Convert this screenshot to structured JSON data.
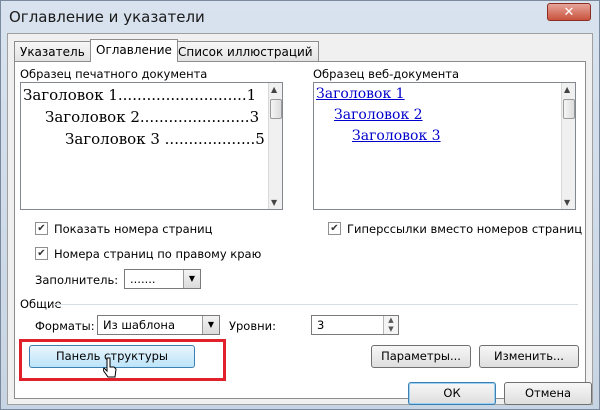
{
  "window": {
    "title": "Оглавление и указатели",
    "close_glyph": "✕"
  },
  "tabs": [
    {
      "label": "Указатель",
      "active": false
    },
    {
      "label": "Оглавление",
      "active": true
    },
    {
      "label": "Список иллюстраций",
      "active": false
    }
  ],
  "print_preview": {
    "label": "Образец печатного документа",
    "lines": [
      "Заголовок 1...........................1",
      "Заголовок 2.......................3",
      "Заголовок 3 ...................5"
    ]
  },
  "web_preview": {
    "label": "Образец веб-документа",
    "lines": [
      "Заголовок 1",
      "Заголовок 2",
      "Заголовок 3"
    ]
  },
  "options": {
    "show_page_numbers": {
      "label": "Показать номера страниц",
      "checked": true
    },
    "right_align": {
      "label": "Номера страниц по правому краю",
      "checked": true
    },
    "hyperlinks": {
      "label": "Гиперссылки вместо номеров страниц",
      "checked": true
    },
    "leader_label": "Заполнитель:",
    "leader_value": "......."
  },
  "general": {
    "label": "Общие",
    "formats_label": "Форматы:",
    "formats_value": "Из шаблона",
    "levels_label": "Уровни:",
    "levels_value": "3"
  },
  "buttons": {
    "outline": "Панель структуры",
    "params": "Параметры...",
    "modify": "Изменить...",
    "ok": "ОК",
    "cancel": "Отмена"
  },
  "colors": {
    "hyperlink": "#0000cc",
    "highlight": "#e0202a"
  }
}
